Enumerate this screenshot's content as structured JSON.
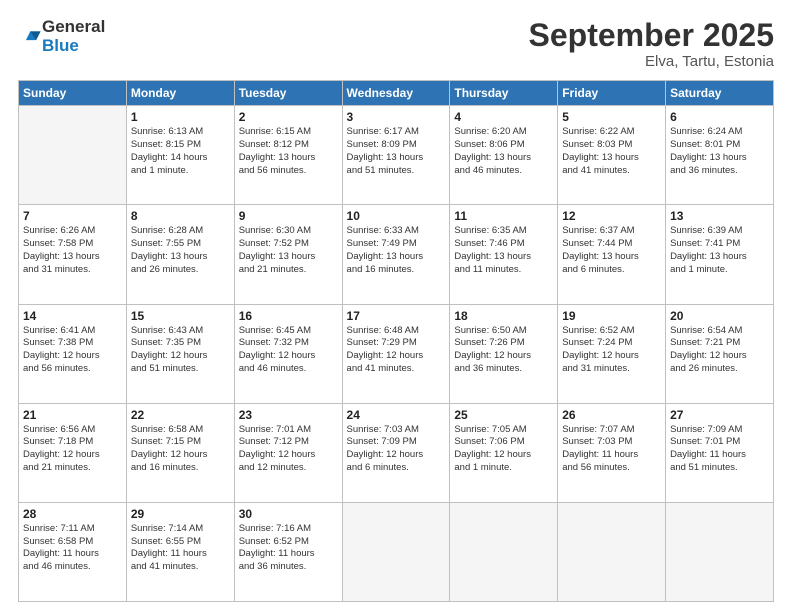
{
  "logo": {
    "general": "General",
    "blue": "Blue"
  },
  "title": {
    "month_year": "September 2025",
    "location": "Elva, Tartu, Estonia"
  },
  "days_of_week": [
    "Sunday",
    "Monday",
    "Tuesday",
    "Wednesday",
    "Thursday",
    "Friday",
    "Saturday"
  ],
  "weeks": [
    [
      {
        "day": "",
        "info": ""
      },
      {
        "day": "1",
        "info": "Sunrise: 6:13 AM\nSunset: 8:15 PM\nDaylight: 14 hours\nand 1 minute."
      },
      {
        "day": "2",
        "info": "Sunrise: 6:15 AM\nSunset: 8:12 PM\nDaylight: 13 hours\nand 56 minutes."
      },
      {
        "day": "3",
        "info": "Sunrise: 6:17 AM\nSunset: 8:09 PM\nDaylight: 13 hours\nand 51 minutes."
      },
      {
        "day": "4",
        "info": "Sunrise: 6:20 AM\nSunset: 8:06 PM\nDaylight: 13 hours\nand 46 minutes."
      },
      {
        "day": "5",
        "info": "Sunrise: 6:22 AM\nSunset: 8:03 PM\nDaylight: 13 hours\nand 41 minutes."
      },
      {
        "day": "6",
        "info": "Sunrise: 6:24 AM\nSunset: 8:01 PM\nDaylight: 13 hours\nand 36 minutes."
      }
    ],
    [
      {
        "day": "7",
        "info": "Sunrise: 6:26 AM\nSunset: 7:58 PM\nDaylight: 13 hours\nand 31 minutes."
      },
      {
        "day": "8",
        "info": "Sunrise: 6:28 AM\nSunset: 7:55 PM\nDaylight: 13 hours\nand 26 minutes."
      },
      {
        "day": "9",
        "info": "Sunrise: 6:30 AM\nSunset: 7:52 PM\nDaylight: 13 hours\nand 21 minutes."
      },
      {
        "day": "10",
        "info": "Sunrise: 6:33 AM\nSunset: 7:49 PM\nDaylight: 13 hours\nand 16 minutes."
      },
      {
        "day": "11",
        "info": "Sunrise: 6:35 AM\nSunset: 7:46 PM\nDaylight: 13 hours\nand 11 minutes."
      },
      {
        "day": "12",
        "info": "Sunrise: 6:37 AM\nSunset: 7:44 PM\nDaylight: 13 hours\nand 6 minutes."
      },
      {
        "day": "13",
        "info": "Sunrise: 6:39 AM\nSunset: 7:41 PM\nDaylight: 13 hours\nand 1 minute."
      }
    ],
    [
      {
        "day": "14",
        "info": "Sunrise: 6:41 AM\nSunset: 7:38 PM\nDaylight: 12 hours\nand 56 minutes."
      },
      {
        "day": "15",
        "info": "Sunrise: 6:43 AM\nSunset: 7:35 PM\nDaylight: 12 hours\nand 51 minutes."
      },
      {
        "day": "16",
        "info": "Sunrise: 6:45 AM\nSunset: 7:32 PM\nDaylight: 12 hours\nand 46 minutes."
      },
      {
        "day": "17",
        "info": "Sunrise: 6:48 AM\nSunset: 7:29 PM\nDaylight: 12 hours\nand 41 minutes."
      },
      {
        "day": "18",
        "info": "Sunrise: 6:50 AM\nSunset: 7:26 PM\nDaylight: 12 hours\nand 36 minutes."
      },
      {
        "day": "19",
        "info": "Sunrise: 6:52 AM\nSunset: 7:24 PM\nDaylight: 12 hours\nand 31 minutes."
      },
      {
        "day": "20",
        "info": "Sunrise: 6:54 AM\nSunset: 7:21 PM\nDaylight: 12 hours\nand 26 minutes."
      }
    ],
    [
      {
        "day": "21",
        "info": "Sunrise: 6:56 AM\nSunset: 7:18 PM\nDaylight: 12 hours\nand 21 minutes."
      },
      {
        "day": "22",
        "info": "Sunrise: 6:58 AM\nSunset: 7:15 PM\nDaylight: 12 hours\nand 16 minutes."
      },
      {
        "day": "23",
        "info": "Sunrise: 7:01 AM\nSunset: 7:12 PM\nDaylight: 12 hours\nand 12 minutes."
      },
      {
        "day": "24",
        "info": "Sunrise: 7:03 AM\nSunset: 7:09 PM\nDaylight: 12 hours\nand 6 minutes."
      },
      {
        "day": "25",
        "info": "Sunrise: 7:05 AM\nSunset: 7:06 PM\nDaylight: 12 hours\nand 1 minute."
      },
      {
        "day": "26",
        "info": "Sunrise: 7:07 AM\nSunset: 7:03 PM\nDaylight: 11 hours\nand 56 minutes."
      },
      {
        "day": "27",
        "info": "Sunrise: 7:09 AM\nSunset: 7:01 PM\nDaylight: 11 hours\nand 51 minutes."
      }
    ],
    [
      {
        "day": "28",
        "info": "Sunrise: 7:11 AM\nSunset: 6:58 PM\nDaylight: 11 hours\nand 46 minutes."
      },
      {
        "day": "29",
        "info": "Sunrise: 7:14 AM\nSunset: 6:55 PM\nDaylight: 11 hours\nand 41 minutes."
      },
      {
        "day": "30",
        "info": "Sunrise: 7:16 AM\nSunset: 6:52 PM\nDaylight: 11 hours\nand 36 minutes."
      },
      {
        "day": "",
        "info": ""
      },
      {
        "day": "",
        "info": ""
      },
      {
        "day": "",
        "info": ""
      },
      {
        "day": "",
        "info": ""
      }
    ]
  ]
}
